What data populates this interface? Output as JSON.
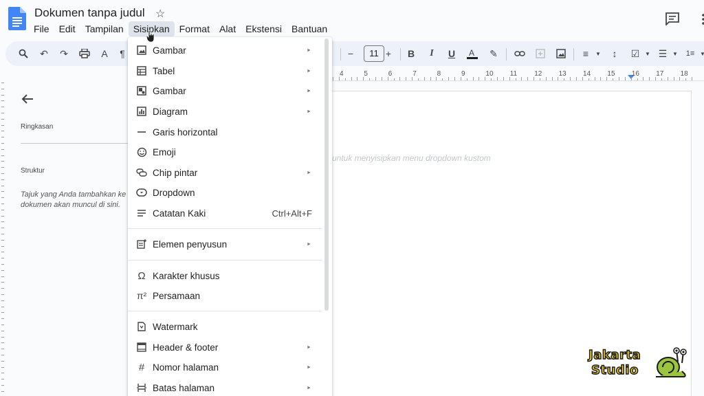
{
  "document": {
    "title": "Dokumen tanpa judul"
  },
  "menubar": {
    "items": [
      "File",
      "Edit",
      "Tampilan",
      "Sisipkan",
      "Format",
      "Alat",
      "Ekstensi",
      "Bantuan"
    ],
    "active": "Sisipkan"
  },
  "toolbar": {
    "font_size": "11"
  },
  "ruler": {
    "numbers": [
      "4",
      "5",
      "6",
      "7",
      "8",
      "9",
      "10",
      "11",
      "12",
      "13",
      "14",
      "15",
      "16",
      "17",
      "18"
    ]
  },
  "outline": {
    "summary_label": "Ringkasan",
    "structure_label": "Struktur",
    "hint": "Tajuk yang Anda tambahkan ke dokumen akan muncul di sini."
  },
  "page": {
    "placeholder": "untuk menyisipkan menu dropdown kustom"
  },
  "insert_menu": {
    "items": [
      {
        "label": "Gambar",
        "icon": "image-icon",
        "submenu": true
      },
      {
        "label": "Tabel",
        "icon": "table-icon",
        "submenu": true
      },
      {
        "label": "Gambar",
        "icon": "drawing-icon",
        "submenu": true
      },
      {
        "label": "Diagram",
        "icon": "chart-icon",
        "submenu": true
      },
      {
        "label": "Garis horizontal",
        "icon": "horizontal-line-icon",
        "submenu": false
      },
      {
        "label": "Emoji",
        "icon": "emoji-icon",
        "submenu": false
      },
      {
        "label": "Chip pintar",
        "icon": "smart-chip-icon",
        "submenu": true
      },
      {
        "label": "Dropdown",
        "icon": "dropdown-icon",
        "submenu": false
      },
      {
        "label": "Catatan Kaki",
        "icon": "footnote-icon",
        "submenu": false,
        "shortcut": "Ctrl+Alt+F"
      },
      {
        "label": "Elemen penyusun",
        "icon": "building-blocks-icon",
        "submenu": true
      },
      {
        "label": "Karakter khusus",
        "icon": "omega-icon",
        "submenu": false
      },
      {
        "label": "Persamaan",
        "icon": "pi-icon",
        "submenu": false
      },
      {
        "label": "Watermark",
        "icon": "watermark-icon",
        "submenu": false
      },
      {
        "label": "Header & footer",
        "icon": "header-footer-icon",
        "submenu": true
      },
      {
        "label": "Nomor halaman",
        "icon": "hash-icon",
        "submenu": true
      },
      {
        "label": "Batas halaman",
        "icon": "page-break-icon",
        "submenu": true
      }
    ]
  },
  "watermark_logo": {
    "line1": "Jakarta",
    "line2": "Studio"
  },
  "colors": {
    "accent": "#4285f4",
    "menu_active_bg": "#dfe3eb",
    "toolbar_bg": "#edf2fa",
    "logo_yellow": "#f7d21b"
  }
}
